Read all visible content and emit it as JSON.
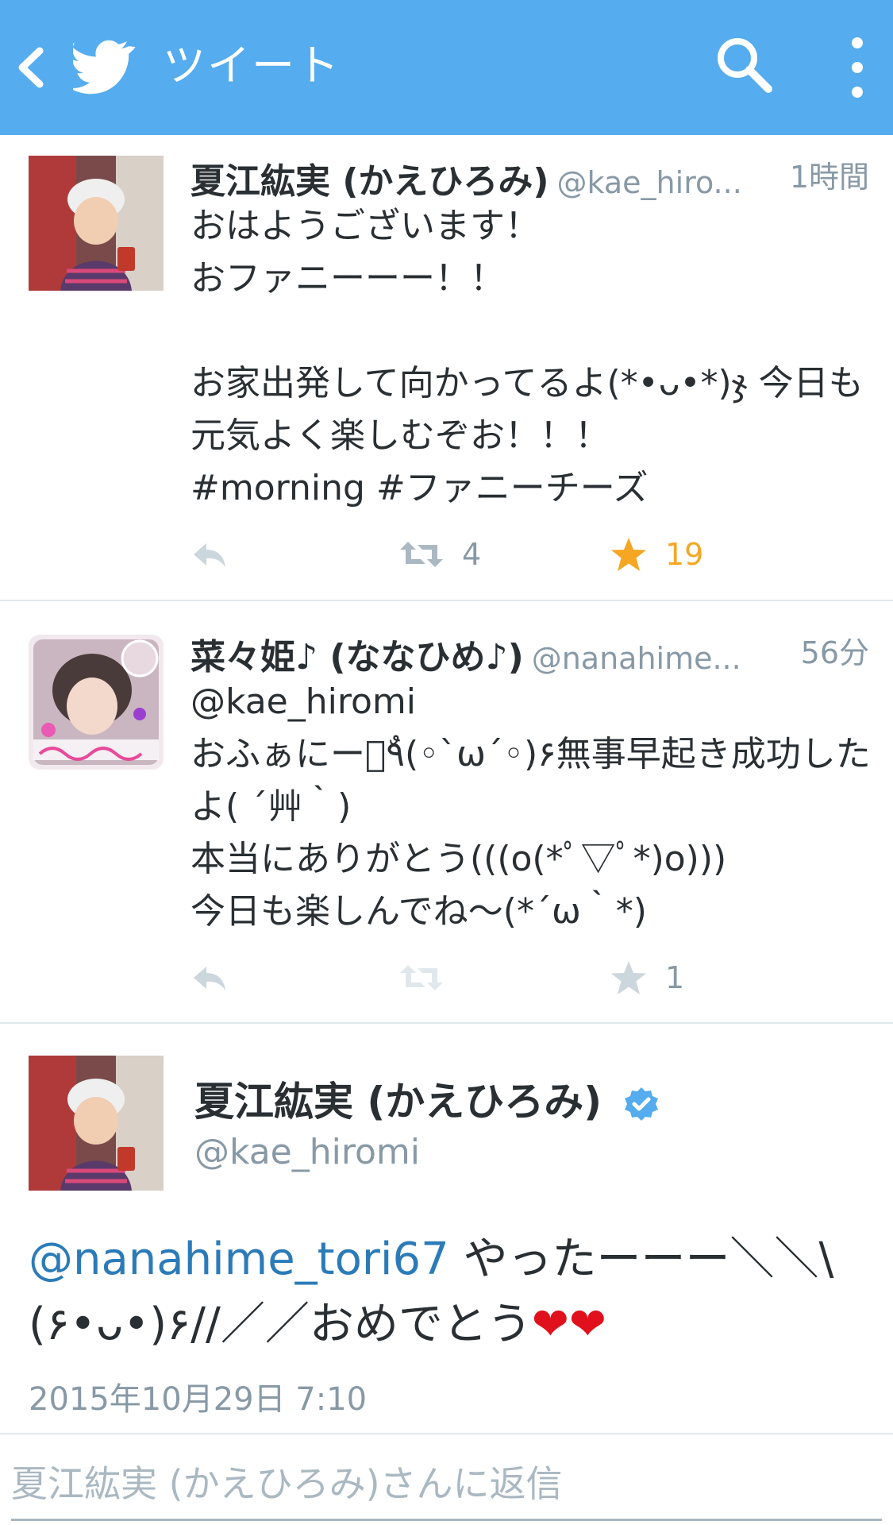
{
  "header": {
    "title": "ツイート",
    "colors": {
      "background": "#55acee",
      "foreground": "#ffffff"
    }
  },
  "tweets": [
    {
      "name": "夏江紘実 (かえひろみ)",
      "handle": "@kae_hiro...",
      "time": "1時間",
      "text": "おはようございます！\nおファニーーー！！\n\nお家出発して向かってるよ(*•ᴗ•*)ჯ 今日も元気よく楽しむぞお！！！\n#morning #ファニーチーズ",
      "retweets": "4",
      "favorites": "19",
      "favorited": true
    },
    {
      "name": "菜々姫♪ (ななひめ♪)",
      "handle": "@nanahime...",
      "time": "56分",
      "text": "@kae_hiromi\nおふぁにーーٌ٩(◦`ω´◦)۶無事早起き成功したよ( ´艸｀)\n本当にありがとう(((o(*ﾟ▽ﾟ*)o)))\n今日も楽しんでね〜(*´ω｀*)",
      "retweets": "",
      "favorites": "1",
      "favorited": false
    }
  ],
  "detail": {
    "name": "夏江紘実 (かえひろみ)",
    "handle": "@kae_hiromi",
    "verified": true,
    "mention": "@nanahime_tori67",
    "text": " やったーーー＼＼\\(۶•ᴗ•)۶//／／おめでとう",
    "hearts": "❤❤",
    "timestamp": "2015年10月29日 7:10"
  },
  "reply": {
    "placeholder": "夏江紘実 (かえひろみ)さんに返信"
  },
  "colors": {
    "accent": "#55acee",
    "star_active": "#f5a623",
    "muted": "#8899a6",
    "link": "#2b7bb9",
    "heart": "#e0111c"
  }
}
